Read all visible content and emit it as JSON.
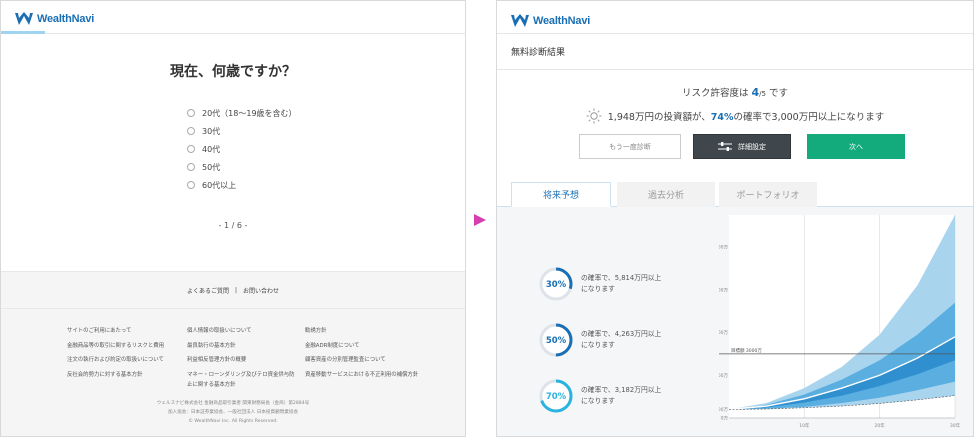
{
  "brand": {
    "name": "WealthNavi",
    "color": "#1a6fb4"
  },
  "left_screen": {
    "question": "現在、何歳ですか？",
    "options": [
      "20代（18〜19歳を含む）",
      "30代",
      "40代",
      "50代",
      "60代以上"
    ],
    "pager": "- 1 / 6 -",
    "progress_fraction": 0.1,
    "footer_top": {
      "faq": "よくあるご質問",
      "separator": "|",
      "contact": "お問い合わせ"
    },
    "footer_columns": [
      [
        "サイトのご利用にあたって",
        "金融商品等の取引に関するリスクと費用",
        "注文の執行および約定の取扱いについて",
        "反社会的勢力に対する基本方針"
      ],
      [
        "個人情報の取扱いについて",
        "最良執行の基本方針",
        "利益相反管理方針の概要",
        "マネー・ローンダリング及びテロ資金供与防",
        "止に関する基本方針"
      ],
      [
        "勧誘方針",
        "金融ADR制度について",
        "顧客資産の分別管理監査について",
        "資産移動サービスにおける不正利用の補償方針"
      ]
    ],
    "copyright": [
      "ウェルスナビ株式会社 金融商品取引業者 関東財務局長（金商）第2884号",
      "加入協会：日本証券業協会、一般社団法人 日本投資顧問業協会",
      "© WealthNavi Inc. All Rights Reserved."
    ]
  },
  "right_screen": {
    "page_title": "無料診断結果",
    "risk": {
      "prefix": "リスク許容度は ",
      "value": "4",
      "denominator": "/5",
      "suffix": " です"
    },
    "projection": {
      "part1": "1,948万円の投資額が、",
      "pct": "74%",
      "part2": "の確率で3,000万円以上になります"
    },
    "buttons": {
      "retry": "もう一度診断",
      "detail": "詳細設定",
      "next": "次へ"
    },
    "tabs": [
      "将来予想",
      "過去分析",
      "ポートフォリオ"
    ],
    "probabilities": [
      {
        "pct": "30%",
        "value": 30,
        "line1": "の確率で、5,814万円以上",
        "line2": "になります"
      },
      {
        "pct": "50%",
        "value": 50,
        "line1": "の確率で、4,263万円以上",
        "line2": "になります"
      },
      {
        "pct": "70%",
        "value": 70,
        "line1": "の確率で、3,182万円以上",
        "line2": "になります"
      }
    ],
    "colors": {
      "accent_green": "#13aa7c",
      "dark_button": "#3f474c",
      "ring_70": "#2bb3e0"
    }
  },
  "chart_data": {
    "type": "area",
    "title": "",
    "xlabel": "",
    "ylabel": "",
    "x": [
      0,
      5,
      10,
      15,
      20,
      25,
      30
    ],
    "x_tick_labels": [
      "10年",
      "20年",
      "30年"
    ],
    "x_ticks": [
      10,
      20,
      30
    ],
    "y_tick_labels": [
      "0万",
      "400万",
      "2000万",
      "4000万",
      "6000万",
      "8000万"
    ],
    "y_ticks": [
      0,
      400,
      2000,
      4000,
      6000,
      8000
    ],
    "ylim": [
      0,
      9500
    ],
    "xlim": [
      0,
      30
    ],
    "target": {
      "label": "目標額 3000万",
      "value": 3000
    },
    "series": [
      {
        "values": [
          400,
          700,
          1400,
          2400,
          3900,
          6200,
          9500
        ]
      },
      {
        "values": [
          400,
          620,
          1100,
          1800,
          2700,
          3900,
          5400
        ]
      },
      {
        "values": [
          400,
          560,
          900,
          1400,
          2000,
          2800,
          3800
        ]
      },
      {
        "values": [
          400,
          500,
          720,
          1050,
          1500,
          2050,
          2700
        ]
      },
      {
        "values": [
          400,
          430,
          520,
          700,
          950,
          1300,
          1700
        ]
      },
      {
        "values": [
          400,
          420,
          480,
          560,
          680,
          850,
          1050
        ]
      }
    ]
  }
}
